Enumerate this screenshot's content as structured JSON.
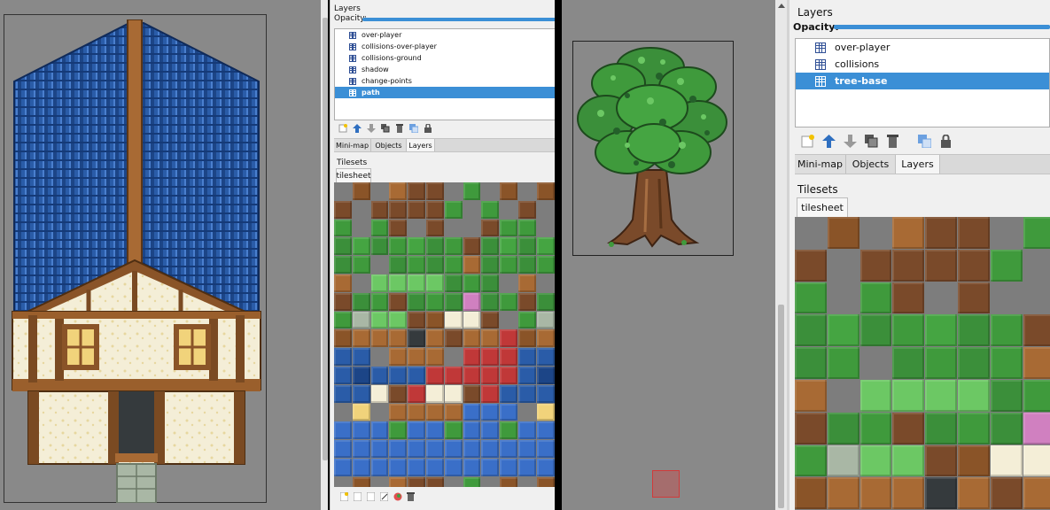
{
  "left_window": {
    "layers_panel": {
      "title": "Layers",
      "opacity_label": "Opacity:",
      "opacity_value": 1.0,
      "layers": [
        {
          "name": "over-player",
          "selected": false
        },
        {
          "name": "collisions-over-player",
          "selected": false
        },
        {
          "name": "collisions-ground",
          "selected": false
        },
        {
          "name": "shadow",
          "selected": false
        },
        {
          "name": "change-points",
          "selected": false
        },
        {
          "name": "path",
          "selected": true
        }
      ]
    },
    "tabs": [
      {
        "label": "Mini-map",
        "active": false
      },
      {
        "label": "Objects",
        "active": false
      },
      {
        "label": "Layers",
        "active": true
      }
    ],
    "tilesets_panel": {
      "title": "Tilesets",
      "tab_label": "tilesheet"
    }
  },
  "right_window": {
    "layers_panel": {
      "title": "Layers",
      "opacity_label": "Opacity:",
      "opacity_value": 1.0,
      "layers": [
        {
          "name": "over-player",
          "selected": false
        },
        {
          "name": "collisions",
          "selected": false
        },
        {
          "name": "tree-base",
          "selected": true
        }
      ]
    },
    "tabs": [
      {
        "label": "Mini-map",
        "active": false
      },
      {
        "label": "Objects",
        "active": false
      },
      {
        "label": "Layers",
        "active": true
      }
    ],
    "tilesets_panel": {
      "title": "Tilesets",
      "tab_label": "tilesheet"
    }
  },
  "colors": {
    "selection": "#3b8fd6",
    "canvas_bg": "#898989",
    "roof_blue": "#2a5ca8",
    "timber_brown": "#7a4a22",
    "leaf_green": "#3f9a3c",
    "cursor_red": "#c94b4b"
  }
}
